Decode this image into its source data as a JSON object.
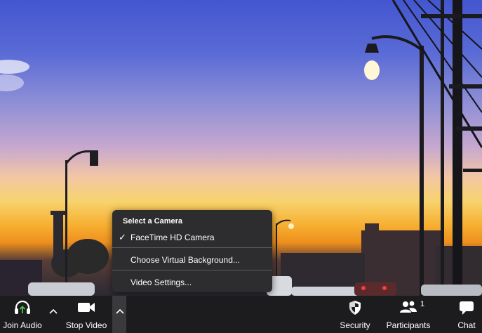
{
  "camera_menu": {
    "heading": "Select a Camera",
    "cameras": [
      {
        "label": "FaceTime HD Camera",
        "selected": true
      }
    ],
    "virtual_background": "Choose Virtual Background...",
    "video_settings": "Video Settings..."
  },
  "toolbar": {
    "join_audio": "Join Audio",
    "stop_video": "Stop Video",
    "security": "Security",
    "participants": "Participants",
    "participants_count": "1",
    "chat": "Chat",
    "icons": {
      "join_audio": "headphones-icon",
      "stop_video": "video-camera-icon",
      "security": "shield-icon",
      "participants": "people-icon",
      "chat": "chat-bubble-icon"
    },
    "accent_audio": "#3fbf3f"
  }
}
